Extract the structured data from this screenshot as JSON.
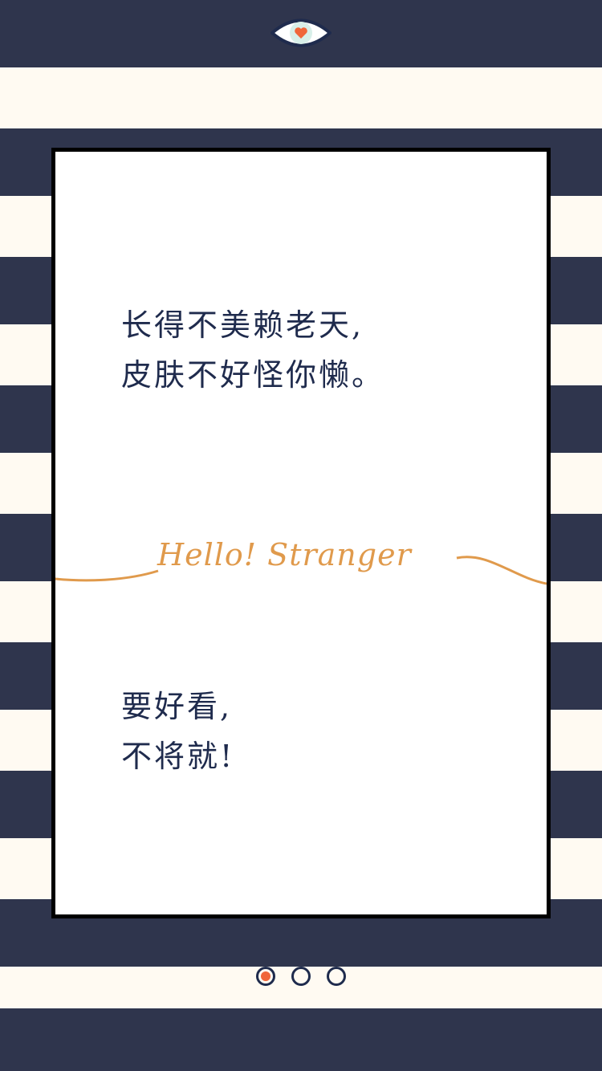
{
  "logo": {
    "icon": "eye-heart-icon"
  },
  "card": {
    "top_lines": [
      "长得不美赖老天,",
      "皮肤不好怪你懒。"
    ],
    "hello": "Hello!  Stranger",
    "bottom_lines": [
      "要好看,",
      "不将就!"
    ]
  },
  "pager": {
    "count": 3,
    "active_index": 0
  },
  "colors": {
    "navy": "#2f354d",
    "cream": "#fffaf2",
    "text": "#1f2b4d",
    "accent_orange": "#f0663a",
    "script_gold": "#e09a4c"
  }
}
